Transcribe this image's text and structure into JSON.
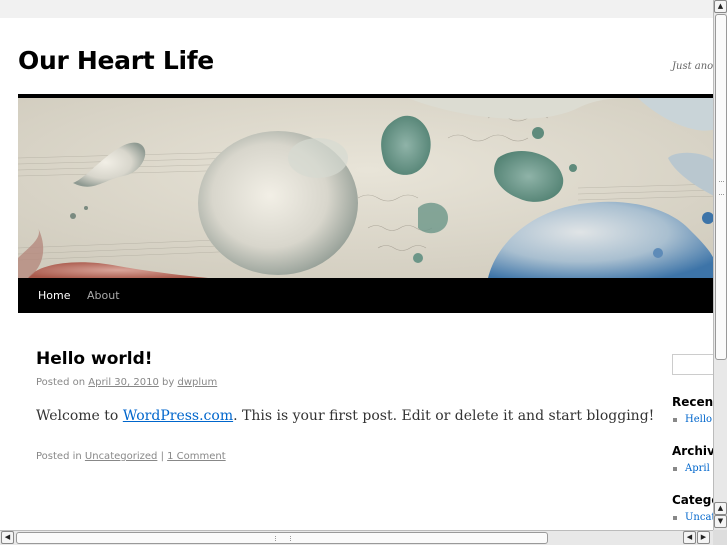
{
  "site": {
    "title": "Our Heart Life",
    "description": "Just ano"
  },
  "nav": {
    "items": [
      {
        "label": "Home"
      },
      {
        "label": "About"
      }
    ]
  },
  "post": {
    "title": "Hello world!",
    "meta_prefix": "Posted on",
    "date": "April 30, 2010",
    "by": "by",
    "author": "dwplum",
    "content_prefix": "Welcome to",
    "content_link": "WordPress.com",
    "content_suffix": ". This is your first post. Edit or delete it and start blogging!",
    "footer_prefix": "Posted in",
    "category": "Uncategorized",
    "separator": "|",
    "comments": "1 Comment"
  },
  "sidebar": {
    "recent_title": "Recen",
    "recent_item": "Hello",
    "archives_title": "Archiv",
    "archives_item": "April",
    "categories_title": "Catego",
    "categories_item": "Uncat"
  },
  "scrollbars": {
    "up_arrow": "▲",
    "down_arrow": "▼",
    "left_arrow": "◀",
    "right_arrow": "▶"
  },
  "colors": {
    "nav_bg": "#000000",
    "link": "#0066cc",
    "meta": "#888888"
  }
}
